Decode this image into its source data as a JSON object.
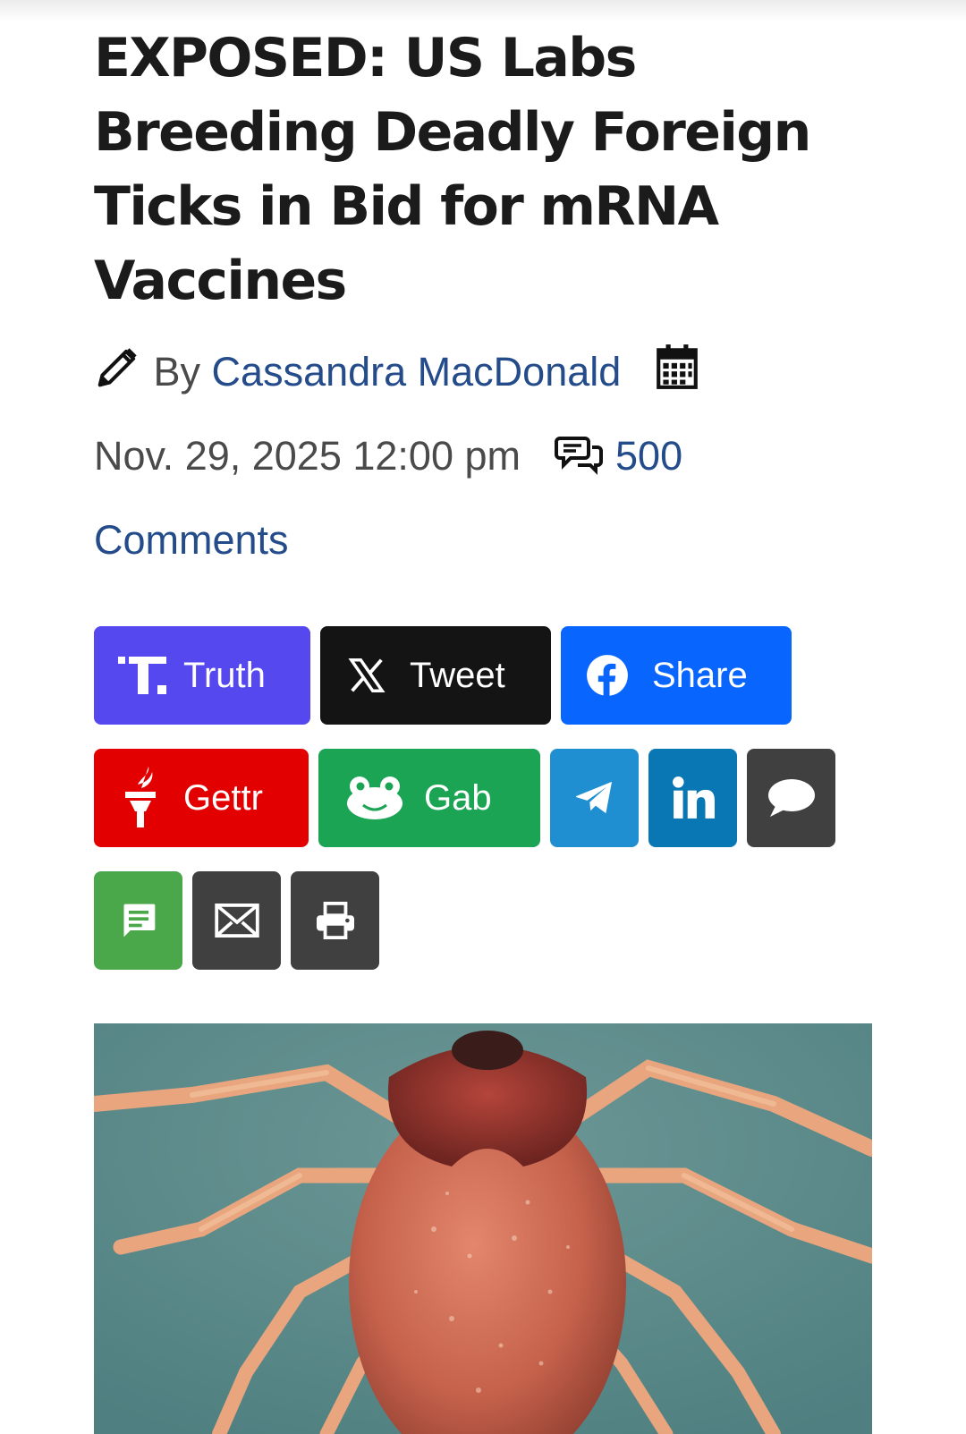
{
  "article": {
    "title": "EXPOSED: US Labs Breeding Deadly Foreign Ticks in Bid for mRNA Vaccines",
    "by_label": "By",
    "author": "Cassandra MacDonald",
    "date": "Nov. 29, 2025 12:00 pm",
    "comments_count": "500",
    "comments_label": "Comments"
  },
  "share": {
    "buttons": [
      {
        "label": "Truth",
        "icon": "truth-social-icon",
        "color": "#5448ee"
      },
      {
        "label": "Tweet",
        "icon": "x-icon",
        "color": "#141414"
      },
      {
        "label": "Share",
        "icon": "facebook-icon",
        "color": "#0866ff"
      },
      {
        "label": "Gettr",
        "icon": "gettr-icon",
        "color": "#e30000"
      },
      {
        "label": "Gab",
        "icon": "gab-frog-icon",
        "color": "#1aa453"
      },
      {
        "label": "",
        "icon": "telegram-icon",
        "color": "#1f8fd1"
      },
      {
        "label": "",
        "icon": "linkedin-icon",
        "color": "#0a77b5"
      },
      {
        "label": "",
        "icon": "comment-bubble-icon",
        "color": "#404040"
      },
      {
        "label": "",
        "icon": "sms-icon",
        "color": "#4aa84a"
      },
      {
        "label": "",
        "icon": "email-icon",
        "color": "#404040"
      },
      {
        "label": "",
        "icon": "print-icon",
        "color": "#404040"
      }
    ]
  },
  "image": {
    "subject": "tick-photo"
  }
}
